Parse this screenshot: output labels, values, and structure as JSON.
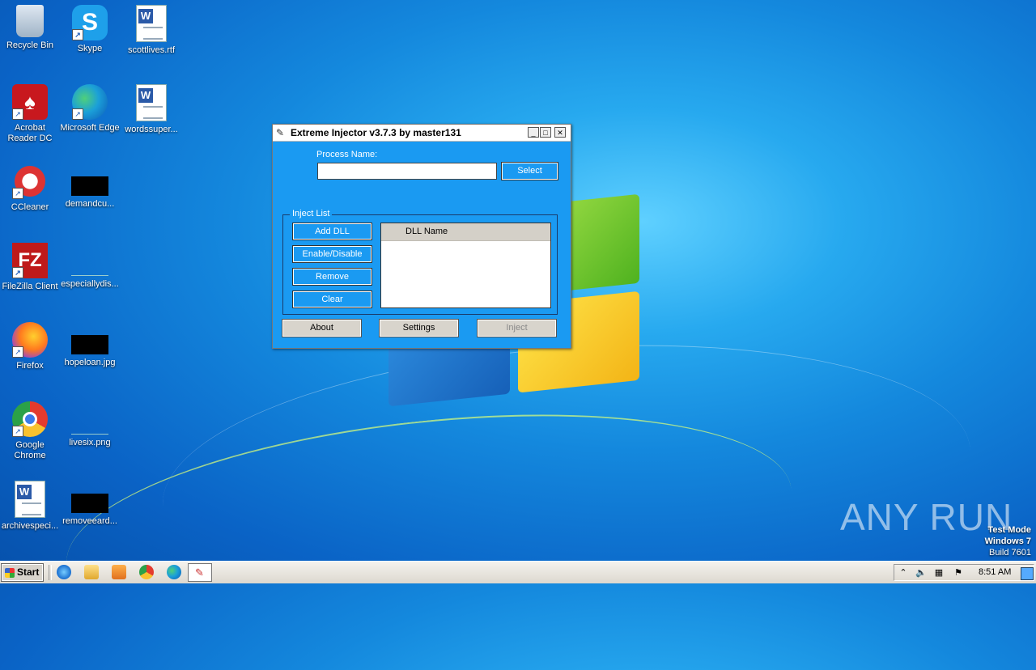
{
  "desktop": {
    "icons": [
      {
        "label": "Recycle Bin",
        "icon": "recycle-bin-icon"
      },
      {
        "label": "Skype",
        "icon": "skype-icon"
      },
      {
        "label": "scottlives.rtf",
        "icon": "word-document-icon"
      },
      {
        "label": "Acrobat Reader DC",
        "icon": "acrobat-icon"
      },
      {
        "label": "Microsoft Edge",
        "icon": "edge-icon"
      },
      {
        "label": "wordssuper...",
        "icon": "word-document-icon"
      },
      {
        "label": "CCleaner",
        "icon": "ccleaner-icon"
      },
      {
        "label": "demandcu...",
        "icon": "image-thumbnail-icon"
      },
      {
        "label": "FileZilla Client",
        "icon": "filezilla-icon"
      },
      {
        "label": "especiallydis...",
        "icon": "image-thumbnail-icon"
      },
      {
        "label": "Firefox",
        "icon": "firefox-icon"
      },
      {
        "label": "hopeloan.jpg",
        "icon": "image-thumbnail-icon"
      },
      {
        "label": "Google Chrome",
        "icon": "chrome-icon"
      },
      {
        "label": "livesix.png",
        "icon": "image-thumbnail-icon"
      },
      {
        "label": "archivespeci...",
        "icon": "word-document-icon"
      },
      {
        "label": "removeeard...",
        "icon": "image-thumbnail-icon"
      }
    ]
  },
  "window": {
    "title": "Extreme Injector v3.7.3 by master131",
    "process_label": "Process Name:",
    "process_value": "",
    "select_label": "Select",
    "inject_list_label": "Inject List",
    "add_dll_label": "Add DLL",
    "enable_disable_label": "Enable/Disable",
    "remove_label": "Remove",
    "clear_label": "Clear",
    "list_column": "DLL Name",
    "about_label": "About",
    "settings_label": "Settings",
    "inject_label": "Inject"
  },
  "watermark": {
    "text": "ANY RUN"
  },
  "os_info": {
    "line1": "Test Mode",
    "line2": "Windows 7",
    "line3": "Build 7601"
  },
  "taskbar": {
    "start_label": "Start",
    "clock": "8:51 AM"
  }
}
